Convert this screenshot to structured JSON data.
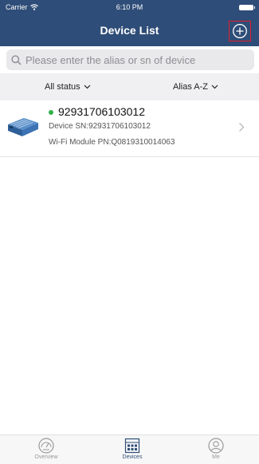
{
  "status_bar": {
    "carrier": "Carrier",
    "time": "6:10 PM"
  },
  "header": {
    "title": "Device List",
    "add_icon": "plus-circle-icon"
  },
  "search": {
    "placeholder": "Please enter the alias or sn of device",
    "value": ""
  },
  "filters": {
    "status_label": "All status",
    "sort_label": "Alias A-Z"
  },
  "devices": [
    {
      "alias": "92931706103012",
      "status_color": "#2fb24c",
      "sn_label": "Device SN:92931706103012",
      "pn_label": "Wi-Fi Module PN:Q0819310014063",
      "image": "inverter-device-icon"
    }
  ],
  "tabs": [
    {
      "label": "Overview",
      "icon": "gauge-icon",
      "active": false
    },
    {
      "label": "Devices",
      "icon": "devices-icon",
      "active": true
    },
    {
      "label": "Me",
      "icon": "user-icon",
      "active": false
    }
  ],
  "colors": {
    "header_bg": "#2e4d78",
    "highlight_border": "#e2202b",
    "online": "#2fb24c"
  }
}
